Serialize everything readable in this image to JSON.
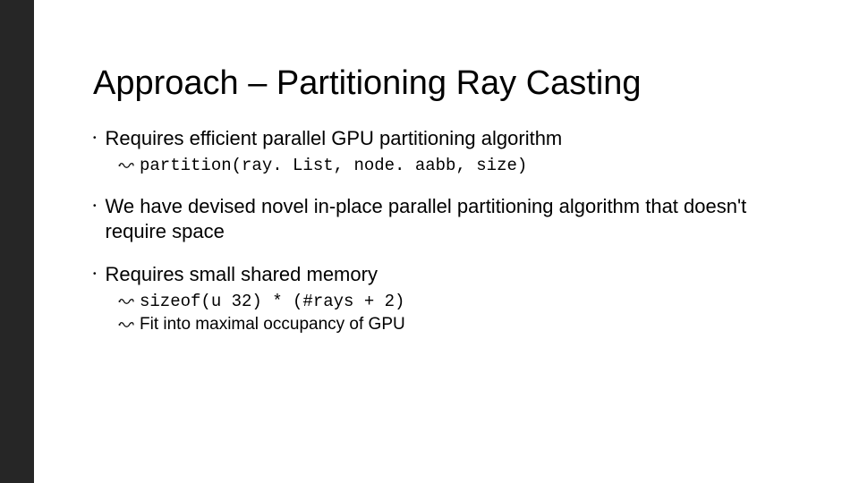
{
  "title": "Approach – Partitioning Ray Casting",
  "bullets": [
    {
      "text": "Requires efficient parallel GPU partitioning algorithm",
      "sub": [
        {
          "text": "partition(ray. List, node. aabb, size)",
          "mono": true
        }
      ]
    },
    {
      "text": "We have devised novel in-place parallel partitioning algorithm that doesn't require space",
      "sub": []
    },
    {
      "text": "Requires small shared memory",
      "sub": [
        {
          "text": "sizeof(u 32) * (#rays + 2)",
          "mono": true
        },
        {
          "text": "Fit into maximal occupancy of GPU",
          "mono": false
        }
      ]
    }
  ]
}
